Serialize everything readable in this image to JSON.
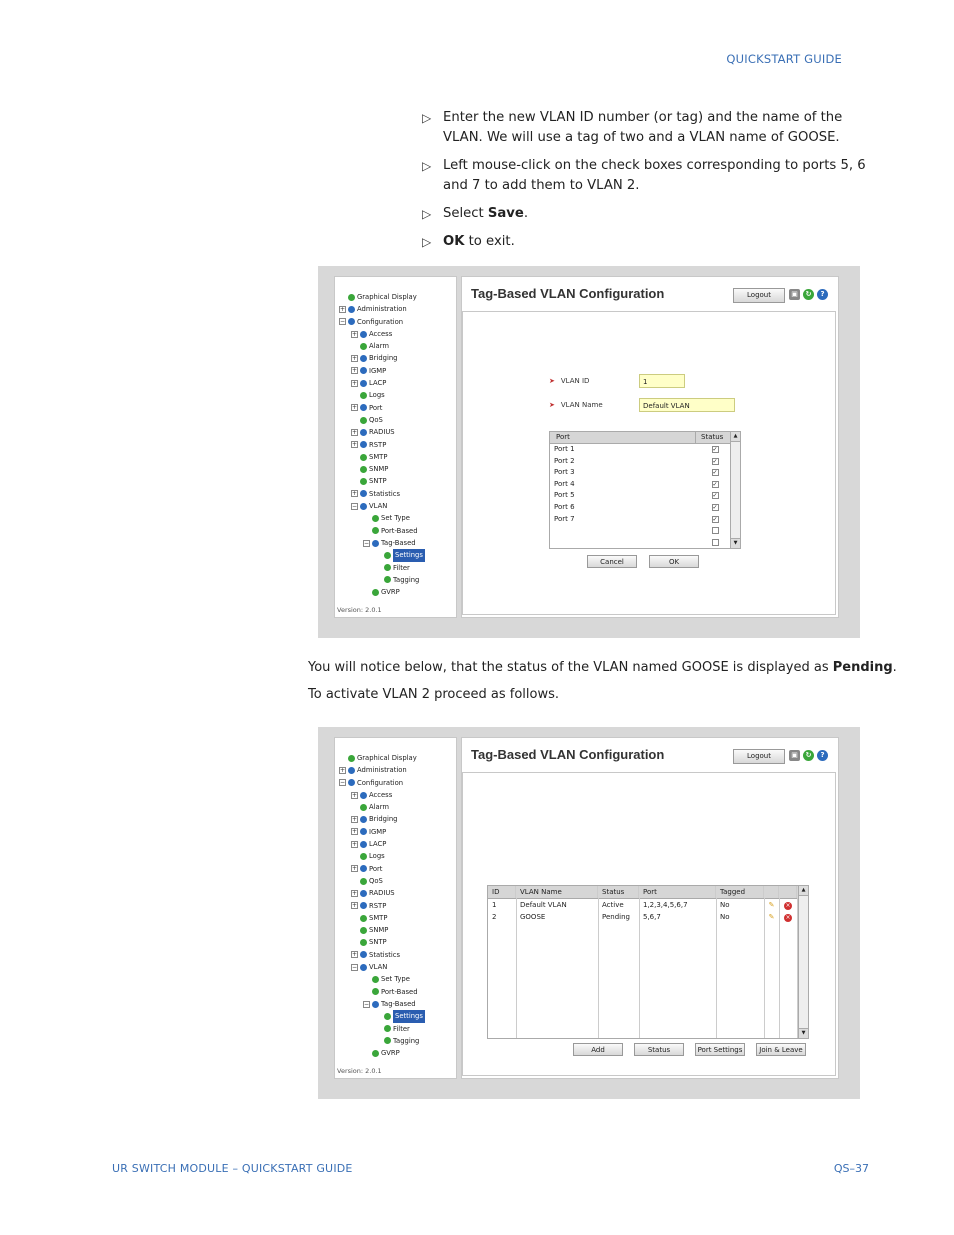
{
  "header": {
    "title": "QUICKSTART GUIDE"
  },
  "steps": [
    {
      "text": "Enter the new VLAN ID number (or tag) and the name of the VLAN. We will use a tag of two and a VLAN name of GOOSE."
    },
    {
      "text": "Left mouse-click on the check boxes corresponding to ports 5, 6 and 7 to add them to  VLAN 2."
    },
    {
      "pre": "Select ",
      "bold": "Save",
      "post": "."
    },
    {
      "pre": "",
      "bold": "OK",
      "post": " to exit."
    }
  ],
  "para1": {
    "pre": "You will notice below, that the status of the VLAN named GOOSE is displayed as ",
    "bold": "Pending",
    "post": "."
  },
  "para2": "To activate VLAN 2 proceed as follows.",
  "tree": [
    {
      "label": "Graphical Display",
      "pm": "",
      "dot": "g",
      "indent": 0
    },
    {
      "label": "Administration",
      "pm": "+",
      "dot": "b",
      "indent": 0
    },
    {
      "label": "Configuration",
      "pm": "-",
      "dot": "b",
      "indent": 0
    },
    {
      "label": "Access",
      "pm": "+",
      "dot": "b",
      "indent": 1
    },
    {
      "label": "Alarm",
      "pm": "",
      "dot": "g",
      "indent": 1
    },
    {
      "label": "Bridging",
      "pm": "+",
      "dot": "b",
      "indent": 1
    },
    {
      "label": "IGMP",
      "pm": "+",
      "dot": "b",
      "indent": 1
    },
    {
      "label": "LACP",
      "pm": "+",
      "dot": "b",
      "indent": 1
    },
    {
      "label": "Logs",
      "pm": "",
      "dot": "g",
      "indent": 1
    },
    {
      "label": "Port",
      "pm": "+",
      "dot": "b",
      "indent": 1
    },
    {
      "label": "QoS",
      "pm": "",
      "dot": "g",
      "indent": 1
    },
    {
      "label": "RADIUS",
      "pm": "+",
      "dot": "b",
      "indent": 1
    },
    {
      "label": "RSTP",
      "pm": "+",
      "dot": "b",
      "indent": 1
    },
    {
      "label": "SMTP",
      "pm": "",
      "dot": "g",
      "indent": 1
    },
    {
      "label": "SNMP",
      "pm": "",
      "dot": "g",
      "indent": 1
    },
    {
      "label": "SNTP",
      "pm": "",
      "dot": "g",
      "indent": 1
    },
    {
      "label": "Statistics",
      "pm": "+",
      "dot": "b",
      "indent": 1
    },
    {
      "label": "VLAN",
      "pm": "-",
      "dot": "b",
      "indent": 1
    },
    {
      "label": "Set Type",
      "pm": "",
      "dot": "g",
      "indent": 2
    },
    {
      "label": "Port-Based",
      "pm": "",
      "dot": "g",
      "indent": 2
    },
    {
      "label": "Tag-Based",
      "pm": "-",
      "dot": "b",
      "indent": 2
    },
    {
      "label": "Settings",
      "pm": "",
      "dot": "g",
      "indent": 3,
      "selected": true
    },
    {
      "label": "Filter",
      "pm": "",
      "dot": "g",
      "indent": 3
    },
    {
      "label": "Tagging",
      "pm": "",
      "dot": "g",
      "indent": 3
    },
    {
      "label": "GVRP",
      "pm": "",
      "dot": "g",
      "indent": 2
    }
  ],
  "app": {
    "version": "Version: 2.0.1",
    "title": "Tag-Based VLAN Configuration",
    "logout": "Logout"
  },
  "form": {
    "vlan_id_label": "VLAN ID",
    "vlan_id_value": "1",
    "vlan_name_label": "VLAN Name",
    "vlan_name_value": "Default VLAN",
    "port_header": "Port",
    "status_header": "Status",
    "ports": [
      {
        "name": "Port 1",
        "checked": true
      },
      {
        "name": "Port 2",
        "checked": true
      },
      {
        "name": "Port 3",
        "checked": true
      },
      {
        "name": "Port 4",
        "checked": true
      },
      {
        "name": "Port 5",
        "checked": true
      },
      {
        "name": "Port 6",
        "checked": true
      },
      {
        "name": "Port 7",
        "checked": true
      },
      {
        "name": "",
        "checked": false
      },
      {
        "name": "",
        "checked": false
      }
    ],
    "cancel": "Cancel",
    "ok": "OK"
  },
  "vlan_table": {
    "headers": [
      "ID",
      "VLAN Name",
      "Status",
      "Port",
      "Tagged"
    ],
    "rows": [
      [
        "1",
        "Default VLAN",
        "Active",
        "1,2,3,4,5,6,7",
        "No"
      ],
      [
        "2",
        "GOOSE",
        "Pending",
        "5,6,7",
        "No"
      ]
    ],
    "buttons": [
      "Add",
      "Status",
      "Port Settings",
      "Join & Leave"
    ]
  },
  "footer": {
    "left": "UR SWITCH MODULE – QUICKSTART GUIDE",
    "right": "QS–37"
  },
  "colors": {
    "accent": "#3a6fb5",
    "selection": "#2a5db0"
  }
}
